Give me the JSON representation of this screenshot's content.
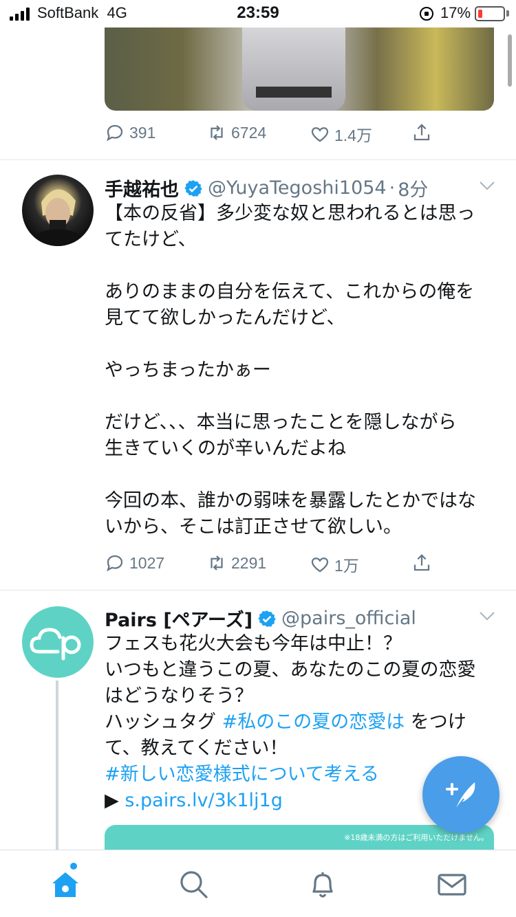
{
  "status_bar": {
    "carrier": "SoftBank",
    "network": "4G",
    "time": "23:59",
    "battery_percent": "17%",
    "battery_level": 0.17,
    "battery_color": "#ff3b30"
  },
  "tweet_top": {
    "reply_count": "391",
    "retweet_count": "6724",
    "like_count": "1.4万"
  },
  "tweet_tegoshi": {
    "display_name": "手越祐也",
    "handle": "@YuyaTegoshi1054",
    "separator": "·",
    "time": "8分",
    "lines": [
      "【本の反省】多少変な奴と思われるとは思っ",
      "てたけど、",
      "",
      "ありのままの自分を伝えて、これからの俺を",
      "見てて欲しかったんだけど、",
      "",
      "やっちまったかぁー",
      "",
      "だけど、、、本当に思ったことを隠しながら",
      "生きていくのが辛いんだよね",
      "",
      "今回の本、誰かの弱味を暴露したとかではな",
      "いから、そこは訂正させて欲しい。"
    ],
    "reply_count": "1027",
    "retweet_count": "2291",
    "like_count": "1万"
  },
  "tweet_pairs": {
    "display_name": "Pairs [ペアーズ]",
    "handle": "@pairs_official",
    "line1": "フェスも花火大会も今年は中止！？",
    "line2": "いつもと違うこの夏、あなたのこの夏の恋愛",
    "line3": "はどうなりそう？",
    "line4_prefix": "ハッシュタグ ",
    "line4_hashtag": "#私のこの夏の恋愛は",
    "line4_suffix": " をつけ",
    "line5": "て、教えてください！",
    "line6_hashtag": "#新しい恋愛様式について考える",
    "line7_arrow": "▶ ",
    "line7_link": "s.pairs.lv/3k1lj1g",
    "card_note": "※18歳未満の方はご利用いただけません。"
  },
  "colors": {
    "accent": "#1da1f2",
    "verified": "#1da1f2",
    "fab": "#4a9de8",
    "pairs_avatar": "#5ed3c5"
  },
  "tabs": [
    {
      "icon": "home-icon",
      "active": true
    },
    {
      "icon": "search-icon",
      "active": false
    },
    {
      "icon": "bell-icon",
      "active": false
    },
    {
      "icon": "mail-icon",
      "active": false
    }
  ]
}
